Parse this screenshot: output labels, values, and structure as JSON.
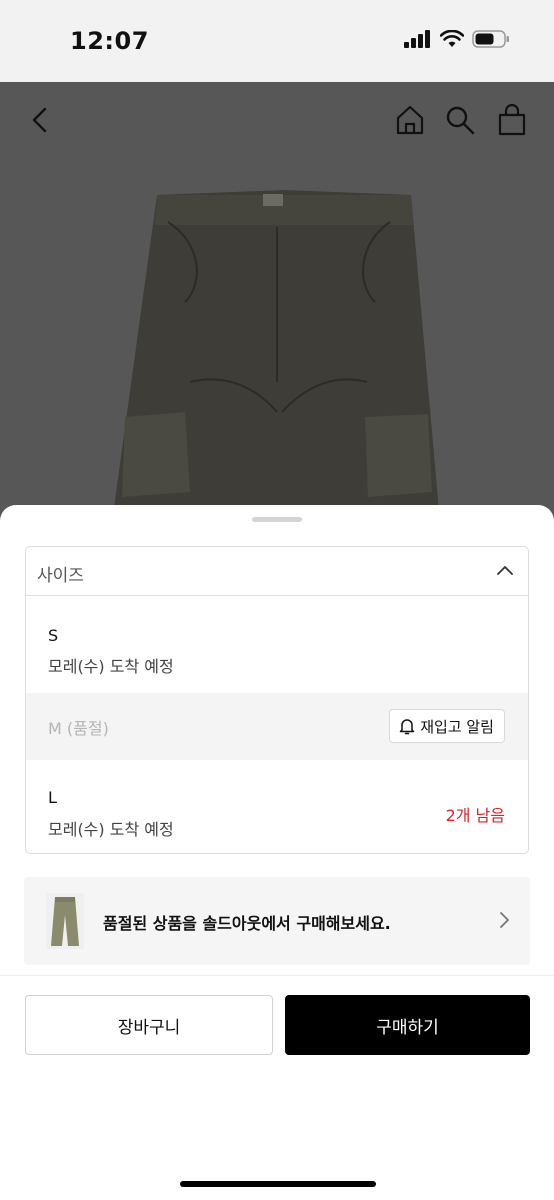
{
  "status_bar": {
    "time": "12:07"
  },
  "option": {
    "header_label": "사이즈",
    "sizes": [
      {
        "name": "S",
        "note": "모레(수) 도착 예정"
      },
      {
        "name": "M (품절)",
        "restock_label": "재입고 알림"
      },
      {
        "name": "L",
        "note": "모레(수) 도착 예정",
        "stock_label": "2개 남음"
      }
    ]
  },
  "soldout_banner": {
    "text": "품절된 상품을 솔드아웃에서 구매해보세요."
  },
  "actions": {
    "cart_label": "장바구니",
    "buy_label": "구매하기"
  },
  "colors": {
    "stock_warning": "#d9242a",
    "buy_button_bg": "#000000",
    "product_bg": "#575757"
  }
}
